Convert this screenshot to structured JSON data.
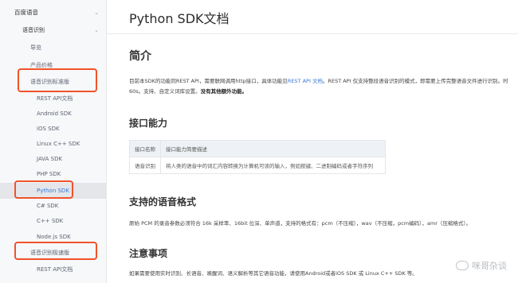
{
  "sidebar": {
    "items": [
      {
        "label": "百度语音",
        "chevron": "⌄"
      },
      {
        "label": "语音识别",
        "chevron": "⌄"
      },
      {
        "label": "导览"
      },
      {
        "label": "产品价格"
      },
      {
        "label": "语音识别标准版",
        "chevron": "⌃"
      },
      {
        "label": "REST API文档"
      },
      {
        "label": "Android SDK"
      },
      {
        "label": "iOS SDK"
      },
      {
        "label": "Linux C++ SDK"
      },
      {
        "label": "JAVA SDK"
      },
      {
        "label": "PHP SDK"
      },
      {
        "label": "Python SDK"
      },
      {
        "label": "C# SDK"
      },
      {
        "label": "C++ SDK"
      },
      {
        "label": "Node.js SDK"
      },
      {
        "label": "语音识别极速版",
        "chevron": "⌃"
      },
      {
        "label": "REST API文档"
      }
    ]
  },
  "main": {
    "title": "Python SDK文档",
    "intro": {
      "heading": "简介",
      "line1_pre": "目前本SDK的功能同REST API，需要联网调用http接口，具体功能见",
      "line1_link": "REST API 文档",
      "line1_post": "。REST API 仅支持整段语音识别的模式，即需要上传完整语音文件进行识别。时",
      "line2_pre": "60s。支持、自定义词库设置。",
      "line2_bold": "没有其他额外功能。"
    },
    "capability": {
      "heading": "接口能力",
      "headers": [
        "接口名称",
        "接口能力简要描述"
      ],
      "rows": [
        [
          "语音识别",
          "将人类的语音中的词汇内容转换为计算机可读的输入，例如按键、二进制编码或者字符序列"
        ]
      ]
    },
    "formats": {
      "heading": "支持的语音格式",
      "text": "原始 PCM 的录音参数必须符合 16k 采样率、16bit 位深、单声道，支持的格式有：pcm（不压缩），wav（不压缩，pcm编码），amr（压缩格式）。"
    },
    "notes": {
      "heading": "注意事项",
      "text": "如果需要使用实时识别、长语音、唤醒词、语义解析等其它语音功能，请使用Android或者iOS SDK 或 Linux C++ SDK 等。"
    }
  },
  "watermark": {
    "text": "咪哥杂谈",
    "icon": "wechat-icon"
  },
  "colors": {
    "annotation": "#f0532a",
    "link": "#3a7bd5",
    "active_bg": "#e4e6ea"
  }
}
